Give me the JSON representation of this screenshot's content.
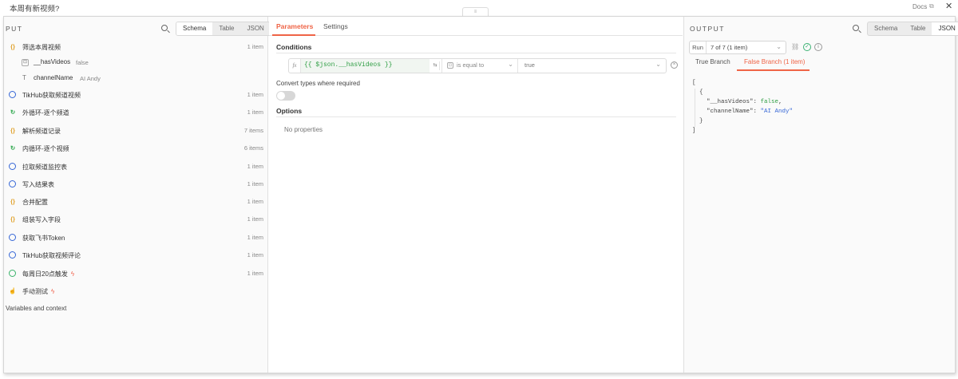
{
  "window": {
    "title": "本周有新视频?",
    "docs_label": "Docs",
    "drag_handle_glyph": "≡"
  },
  "input_panel": {
    "header": "PUT",
    "tabs": [
      "Schema",
      "Table",
      "JSON"
    ],
    "active_tab": "Schema",
    "nodes": [
      {
        "label": "筛选本周视频",
        "count": "1 item",
        "icon": "object-braces-icon"
      },
      {
        "label": "TikHub获取频道视频",
        "count": "1 item",
        "icon": "globe-icon"
      },
      {
        "label": "外循环-逐个频道",
        "count": "1 item",
        "icon": "loop-icon"
      },
      {
        "label": "解析频道记录",
        "count": "7 items",
        "icon": "object-braces-icon"
      },
      {
        "label": "内循环-逐个视频",
        "count": "6 items",
        "icon": "loop-icon"
      },
      {
        "label": "拉取频道监控表",
        "count": "1 item",
        "icon": "globe-icon"
      },
      {
        "label": "写入结果表",
        "count": "1 item",
        "icon": "globe-icon"
      },
      {
        "label": "合并配置",
        "count": "1 item",
        "icon": "object-braces-icon"
      },
      {
        "label": "组装写入字段",
        "count": "1 item",
        "icon": "object-braces-icon"
      },
      {
        "label": "获取飞书Token",
        "count": "1 item",
        "icon": "globe-icon"
      },
      {
        "label": "TikHub获取视频评论",
        "count": "1 item",
        "icon": "globe-icon"
      },
      {
        "label": "每周日20点触发",
        "count": "1 item",
        "icon": "clock-icon",
        "trigger": true
      },
      {
        "label": "手动测试",
        "count": "",
        "icon": "cursor-icon",
        "trigger": true
      }
    ],
    "fields": [
      {
        "name": "__hasVideos",
        "value": "false",
        "type_glyph": "⊡"
      },
      {
        "name": "channelName",
        "value": "AI Andy",
        "type_glyph": "T"
      }
    ],
    "variables_label": "Variables and context"
  },
  "parameters_panel": {
    "tabs": [
      "Parameters",
      "Settings"
    ],
    "active_tab": "Parameters",
    "conditions_title": "Conditions",
    "condition": {
      "fx_label": "fx",
      "left_value": "{{ $json.__hasVideos }}",
      "operator": "is equal to",
      "right_value": "true"
    },
    "convert_types_label": "Convert types where required",
    "convert_types_enabled": false,
    "options_title": "Options",
    "no_properties": "No properties"
  },
  "output_panel": {
    "header": "OUTPUT",
    "tabs": [
      "Schema",
      "Table",
      "JSON"
    ],
    "active_tab": "JSON",
    "run_label": "Run",
    "run_selection": "7 of 7 (1 item)",
    "branch_tabs": [
      "True Branch",
      "False Branch (1 item)"
    ],
    "active_branch": "False Branch (1 item)",
    "json_lines": {
      "open_arr": "[",
      "open_obj": "{",
      "key1": "\"__hasVideos\"",
      "val1": "false",
      "key2": "\"channelName\"",
      "val2": "\"AI Andy\"",
      "close_obj": "}",
      "close_arr": "]"
    }
  },
  "colors": {
    "accent": "#ef6446",
    "expression_green": "#2f9e44",
    "http_blue": "#3566d6",
    "object_orange": "#e0a12a",
    "loop_green": "#2ea84d"
  }
}
